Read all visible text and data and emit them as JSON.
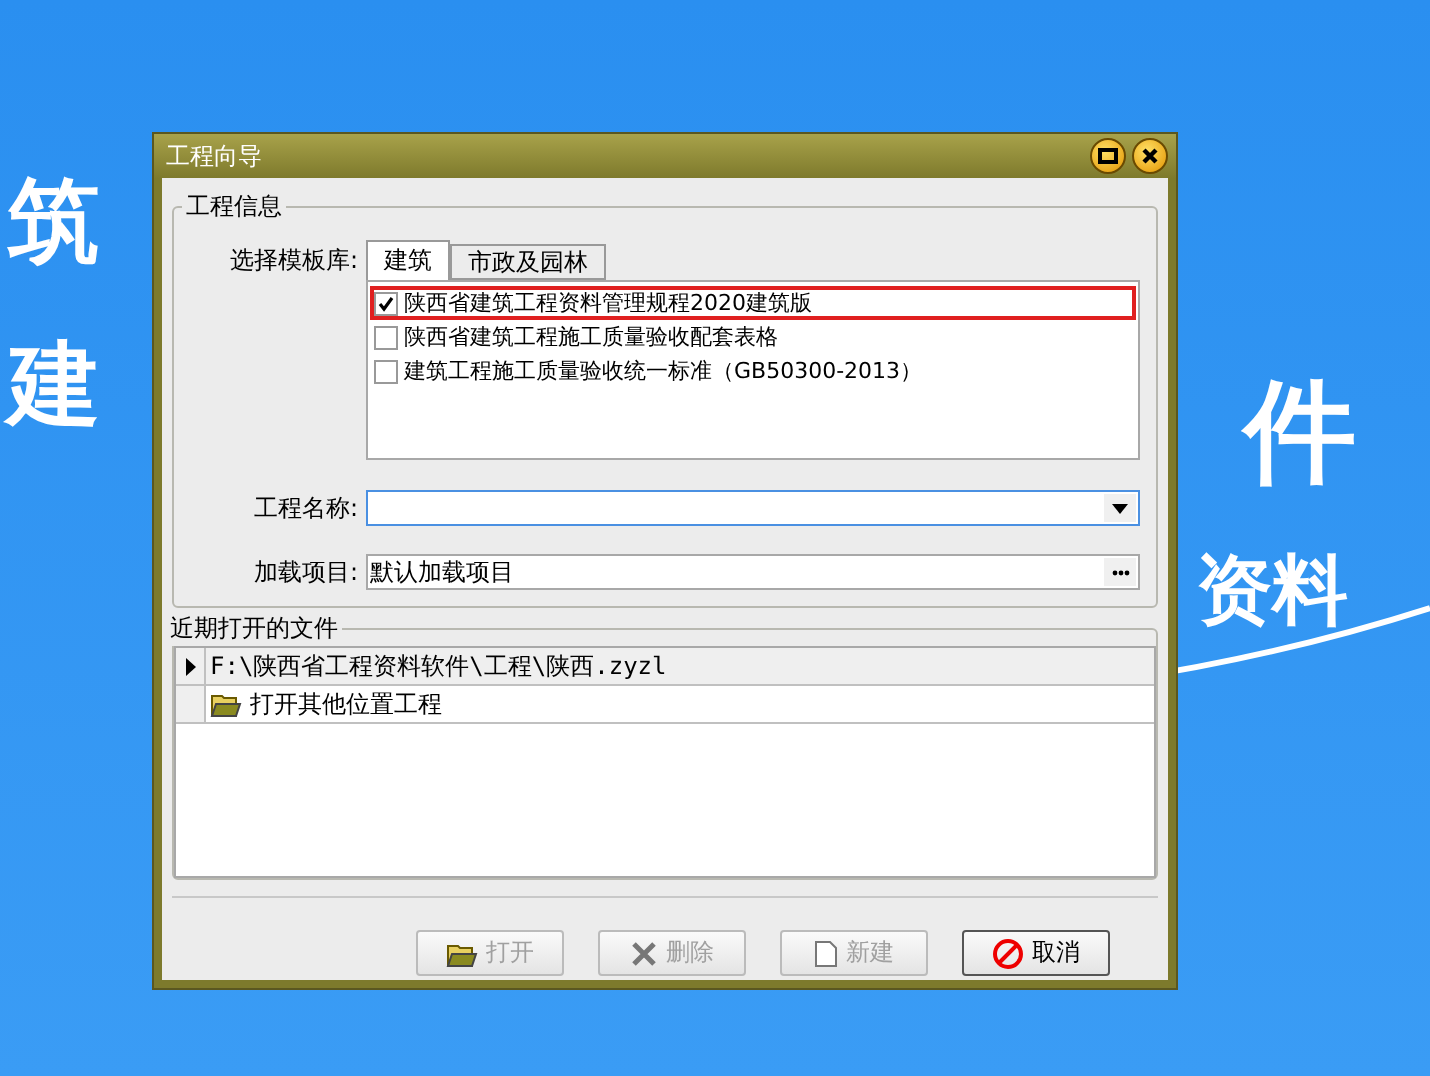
{
  "background": {
    "texts": [
      "筑",
      "建",
      "件",
      "资料"
    ]
  },
  "window": {
    "title": "工程向导"
  },
  "project_info": {
    "title": "工程信息",
    "template_label": "选择模板库:",
    "tabs": [
      {
        "label": "建筑",
        "selected": true
      },
      {
        "label": "市政及园林",
        "selected": false
      }
    ],
    "templates": [
      {
        "label": "陕西省建筑工程资料管理规程2020建筑版",
        "checked": true,
        "highlighted": true
      },
      {
        "label": "陕西省建筑工程施工质量验收配套表格",
        "checked": false,
        "highlighted": false
      },
      {
        "label": "建筑工程施工质量验收统一标准（GB50300-2013）",
        "checked": false,
        "highlighted": false
      }
    ],
    "name_label": "工程名称:",
    "load_label": "加载项目:",
    "load_value": "默认加载项目"
  },
  "recent": {
    "title": "近期打开的文件",
    "rows": [
      {
        "kind": "file",
        "text": "F:\\陕西省工程资料软件\\工程\\陕西.zyzl",
        "selected": true
      },
      {
        "kind": "open-other",
        "text": "打开其他位置工程",
        "selected": false
      }
    ]
  },
  "buttons": [
    {
      "kind": "open",
      "label": "打开",
      "disabled": true
    },
    {
      "kind": "delete",
      "label": "删除",
      "disabled": true
    },
    {
      "kind": "new",
      "label": "新建",
      "disabled": true
    },
    {
      "kind": "cancel",
      "label": "取消",
      "disabled": false
    }
  ]
}
